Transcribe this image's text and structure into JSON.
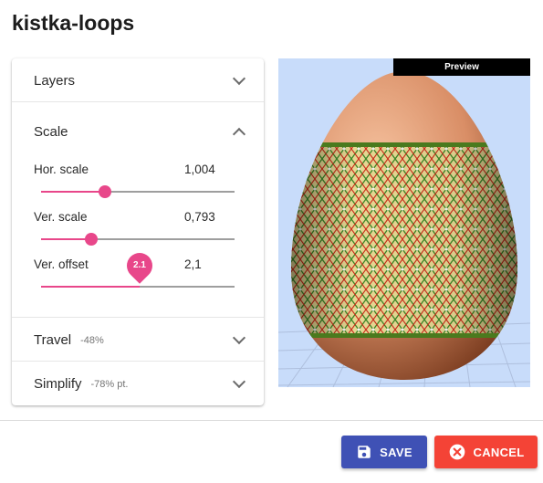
{
  "page": {
    "title": "kistka-loops"
  },
  "accordion": {
    "layers": {
      "label": "Layers",
      "expanded": false
    },
    "scale": {
      "label": "Scale",
      "expanded": true,
      "sliders": [
        {
          "label": "Hor. scale",
          "value": "1,004",
          "fraction": 0.33
        },
        {
          "label": "Ver. scale",
          "value": "0,793",
          "fraction": 0.26
        },
        {
          "label": "Ver. offset",
          "value": "2,1",
          "fraction": 0.51,
          "badge": "2.1"
        }
      ]
    },
    "travel": {
      "label": "Travel",
      "secondary": "-48%",
      "expanded": false
    },
    "simplify": {
      "label": "Simplify",
      "secondary": "-78% pt.",
      "expanded": false
    }
  },
  "preview": {
    "label": "Preview"
  },
  "actions": {
    "save": {
      "label": "SAVE",
      "icon": "save-icon"
    },
    "cancel": {
      "label": "CANCEL",
      "icon": "cancel-icon"
    }
  },
  "colors": {
    "accent": "#e8478a",
    "primary": "#3f51b5",
    "danger": "#f44336",
    "preview_bg": "#c8dcfa"
  }
}
